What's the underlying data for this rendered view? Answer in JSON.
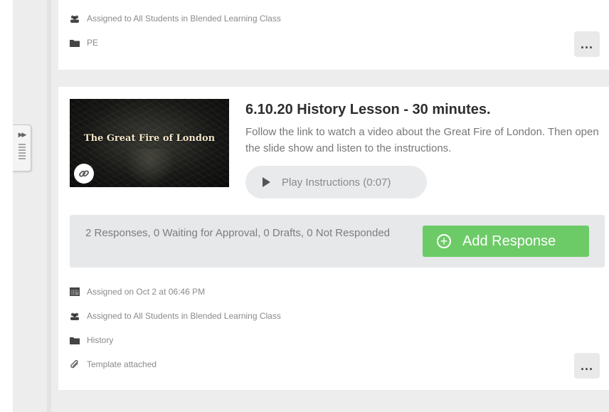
{
  "top_card": {
    "assigned_to": "Assigned to All Students in Blended Learning Class",
    "folder": "PE",
    "more_label": "..."
  },
  "lesson_card": {
    "title": "6.10.20 History Lesson - 30 minutes.",
    "description": "Follow the link to watch a video about the Great Fire of London. Then open the slide show and listen to the instructions.",
    "thumbnail_text": "The Great Fire of London",
    "play_instructions_label": "Play Instructions (0:07)",
    "responses_summary": "2 Responses, 0 Waiting for Approval, 0 Drafts, 0 Not Responded",
    "add_response_label": "Add Response",
    "assigned_on": "Assigned on Oct 2 at 06:46 PM",
    "assigned_to": "Assigned to All Students in Blended Learning Class",
    "folder": "History",
    "template": "Template attached",
    "more_label": "..."
  },
  "colors": {
    "accent_green": "#6ccb66",
    "background": "#ededed",
    "card": "#ffffff"
  },
  "icons": {
    "sidebar_toggle": "double-chevron-right-icon",
    "assigned_to": "users-icon",
    "folder": "folder-icon",
    "calendar": "calendar-icon",
    "template": "paperclip-icon",
    "link": "link-icon",
    "play": "play-icon",
    "add": "plus-circle-icon"
  }
}
